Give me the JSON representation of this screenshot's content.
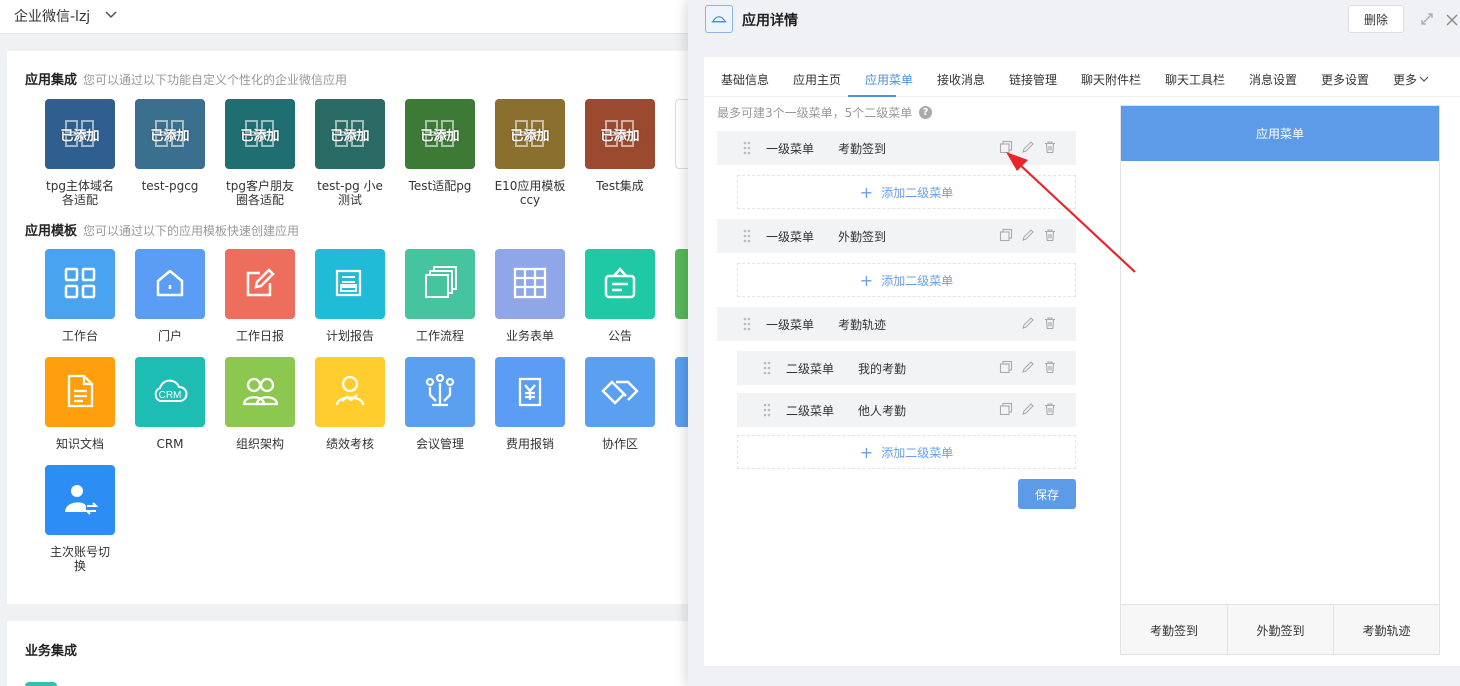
{
  "topbar": {
    "org_name": "企业微信-lzj"
  },
  "integration": {
    "title": "应用集成",
    "subtitle": "您可以通过以下功能自定义个性化的企业微信应用",
    "added_badge": "已添加",
    "apps": [
      {
        "line1": "tpg主体域名",
        "line2": "各适配",
        "color": "#2f5f8f"
      },
      {
        "line1": "test-pgcg",
        "line2": "",
        "color": "#3a6f8e"
      },
      {
        "line1": "tpg客户朋友",
        "line2": "圈各适配",
        "color": "#1f6e72"
      },
      {
        "line1": "test-pg 小e",
        "line2": "测试",
        "color": "#2a6b65"
      },
      {
        "line1": "Test适配pg",
        "line2": "",
        "color": "#3d7a35"
      },
      {
        "line1": "E10应用模板",
        "line2": "ccy",
        "color": "#8b6f2e"
      },
      {
        "line1": "Test集成",
        "line2": "",
        "color": "#9b4a30"
      }
    ]
  },
  "templates": {
    "title": "应用模板",
    "subtitle": "您可以通过以下的应用模板快速创建应用",
    "row1": [
      {
        "label": "工作台",
        "color": "#4aa3f0",
        "icon": "grid-icon"
      },
      {
        "label": "门户",
        "color": "#5b9cf5",
        "icon": "house-icon"
      },
      {
        "label": "工作日报",
        "color": "#ee6e5d",
        "icon": "edit-icon"
      },
      {
        "label": "计划报告",
        "color": "#1fbbd7",
        "icon": "document-icon"
      },
      {
        "label": "工作流程",
        "color": "#45c49e",
        "icon": "stack-icon"
      },
      {
        "label": "业务表单",
        "color": "#8fa6e8",
        "icon": "table-icon"
      },
      {
        "label": "公告",
        "color": "#20c9a5",
        "icon": "notice-icon"
      }
    ],
    "row2": [
      {
        "label": "知识文档",
        "color": "#ff9f0e",
        "icon": "file-icon"
      },
      {
        "label": "CRM",
        "color": "#1dbdb4",
        "icon": "cloud-icon"
      },
      {
        "label": "组织架构",
        "color": "#8cc84f",
        "icon": "people-icon"
      },
      {
        "label": "绩效考核",
        "color": "#ffcd2e",
        "icon": "person-chart-icon"
      },
      {
        "label": "会议管理",
        "color": "#5a9ff0",
        "icon": "meeting-icon"
      },
      {
        "label": "费用报销",
        "color": "#5b9cf5",
        "icon": "yen-icon"
      },
      {
        "label": "协作区",
        "color": "#5a9ff0",
        "icon": "handshake-icon"
      }
    ],
    "row3": [
      {
        "label_line1": "主次账号切",
        "label_line2": "换",
        "color": "#2c8ef5",
        "icon": "account-switch-icon"
      }
    ]
  },
  "business": {
    "title": "业务集成"
  },
  "drawer": {
    "title": "应用详情",
    "delete_label": "删除",
    "tabs": [
      "基础信息",
      "应用主页",
      "应用菜单",
      "接收消息",
      "链接管理",
      "聊天附件栏",
      "聊天工具栏",
      "消息设置",
      "更多设置",
      "更多"
    ],
    "active_tab": "应用菜单",
    "hint": "最多可建3个一级菜单，5个二级菜单",
    "help": "?",
    "level1_label": "一级菜单",
    "level2_label": "二级菜单",
    "add_sub_label": "添加二级菜单",
    "menus": [
      {
        "name": "考勤签到"
      },
      {
        "name": "外勤签到"
      },
      {
        "name": "考勤轨迹",
        "children": [
          {
            "name": "我的考勤"
          },
          {
            "name": "他人考勤"
          }
        ]
      }
    ],
    "save_label": "保存",
    "preview": {
      "header": "应用菜单",
      "footer_tabs": [
        "考勤签到",
        "外勤签到",
        "考勤轨迹"
      ]
    }
  },
  "colors": {
    "accent": "#4a8fe0",
    "preview_header": "#5d9be8",
    "annotation_arrow": "#e8262a"
  }
}
